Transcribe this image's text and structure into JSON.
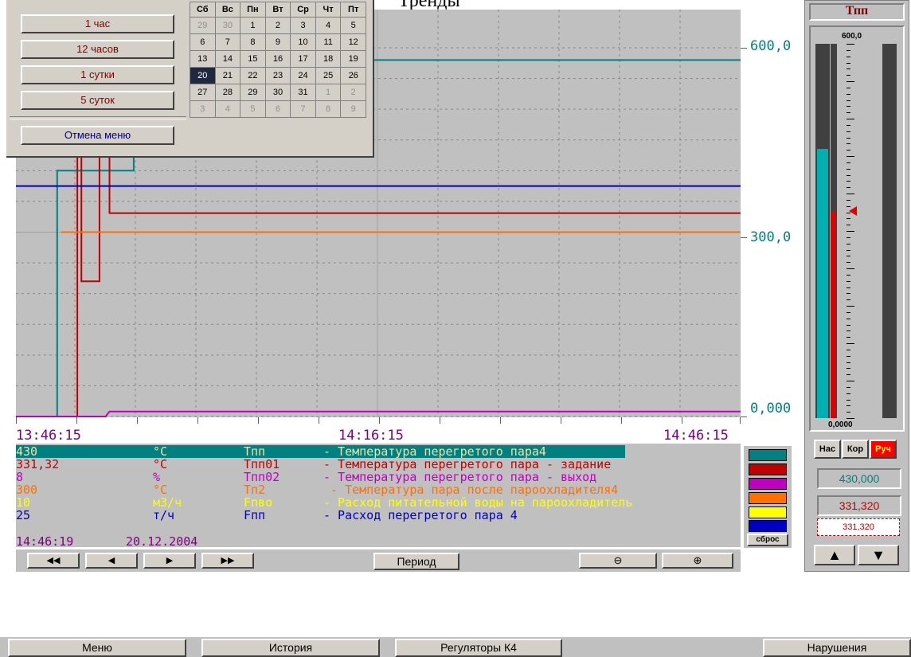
{
  "window_title": "Тренды",
  "axes": {
    "y_labels": [
      "600,0",
      "300,0",
      "0,000"
    ],
    "x_labels": [
      "13:46:15",
      "14:16:15",
      "14:46:15"
    ]
  },
  "period_menu": {
    "items": [
      "1 час",
      "12 часов",
      "1 сутки",
      "5 суток"
    ],
    "cancel": "Отмена меню"
  },
  "calendar": {
    "weekdays": [
      "Сб",
      "Вс",
      "Пн",
      "Вт",
      "Ср",
      "Чт",
      "Пт"
    ],
    "weeks": [
      [
        {
          "d": "29",
          "g": true
        },
        {
          "d": "30",
          "g": true
        },
        {
          "d": "1"
        },
        {
          "d": "2"
        },
        {
          "d": "3"
        },
        {
          "d": "4"
        },
        {
          "d": "5"
        }
      ],
      [
        {
          "d": "6"
        },
        {
          "d": "7"
        },
        {
          "d": "8"
        },
        {
          "d": "9"
        },
        {
          "d": "10"
        },
        {
          "d": "11"
        },
        {
          "d": "12"
        }
      ],
      [
        {
          "d": "13"
        },
        {
          "d": "14"
        },
        {
          "d": "15"
        },
        {
          "d": "16"
        },
        {
          "d": "17"
        },
        {
          "d": "18"
        },
        {
          "d": "19"
        }
      ],
      [
        {
          "d": "20",
          "sel": true
        },
        {
          "d": "21"
        },
        {
          "d": "22"
        },
        {
          "d": "23"
        },
        {
          "d": "24"
        },
        {
          "d": "25"
        },
        {
          "d": "26"
        }
      ],
      [
        {
          "d": "27"
        },
        {
          "d": "28"
        },
        {
          "d": "29"
        },
        {
          "d": "30"
        },
        {
          "d": "31"
        },
        {
          "d": "1",
          "g": true
        },
        {
          "d": "2",
          "g": true
        }
      ],
      [
        {
          "d": "3",
          "g": true
        },
        {
          "d": "4",
          "g": true
        },
        {
          "d": "5",
          "g": true
        },
        {
          "d": "6",
          "g": true
        },
        {
          "d": "7",
          "g": true
        },
        {
          "d": "8",
          "g": true
        },
        {
          "d": "9",
          "g": true
        }
      ]
    ]
  },
  "legend": {
    "rows": [
      {
        "value": "430",
        "unit": "°C",
        "tag": "Tпп",
        "desc": "- Температура перегретого пара4",
        "color": "#f0e0a0",
        "highlight": true
      },
      {
        "value": "331,32",
        "unit": "°C",
        "tag": "Tпп01",
        "desc": "- Температура перегретого пара - задание",
        "color": "#c00000"
      },
      {
        "value": "8",
        "unit": "%",
        "tag": "Tпп02",
        "desc": "- Температура перегретого пара - выход",
        "color": "#c000c0"
      },
      {
        "value": "300",
        "unit": "°C",
        "tag": "Tп2",
        "desc": " - Температура пара после пароохладителя4",
        "color": "#ff7000"
      },
      {
        "value": "10",
        "unit": "м3/ч",
        "tag": "Fпво",
        "desc": "- Расход питательной воды на пароохладитель",
        "color": "#ffff00"
      },
      {
        "value": "25",
        "unit": "т/ч",
        "tag": "Fпп",
        "desc": "- Расход перегретого пара 4",
        "color": "#0000c0"
      }
    ],
    "timestamp": "14:46:19",
    "date": "20.12.2004",
    "swatches": [
      "#008080",
      "#c00000",
      "#c000c0",
      "#ff7000",
      "#ffff00",
      "#0000c0"
    ],
    "reset_label": "сброс"
  },
  "nav": {
    "fast_back": "◀◀",
    "back": "◀",
    "forward": "▶",
    "fast_forward": "▶▶",
    "period": "Период",
    "zoom_out": "⊖",
    "zoom_in": "⊕"
  },
  "indicator": {
    "title": "Тпп",
    "max": "600,0",
    "min": "0,0000",
    "level_teal": 0.72,
    "level_red": 0.553,
    "mode_nas": "Нас",
    "mode_kor": "Кор",
    "mode_ruch": "Руч",
    "value1": "430,000",
    "value2": "331,320",
    "value3": "331,320",
    "up": "▲",
    "down": "▼"
  },
  "taskbar": {
    "menu": "Меню",
    "history": "История",
    "regulators": "Регуляторы К4",
    "violations": "Нарушения"
  },
  "chart_data": {
    "type": "line",
    "x": [
      "13:46:15",
      "14:16:15",
      "14:46:15"
    ],
    "ylim": [
      0,
      600
    ],
    "grid": true,
    "series": [
      {
        "name": "Tпп",
        "color": "#008080",
        "points": [
          [
            "13:46:15",
            0
          ],
          [
            "13:49:40",
            0
          ],
          [
            "13:49:40",
            400
          ],
          [
            "13:56:00",
            400
          ],
          [
            "13:56:00",
            580
          ],
          [
            "14:46:15",
            580
          ]
        ]
      },
      {
        "name": "Tпп01",
        "color": "#c00000",
        "points": [
          [
            "13:51:20",
            0
          ],
          [
            "13:51:20",
            540
          ],
          [
            "13:51:40",
            540
          ],
          [
            "13:51:40",
            220
          ],
          [
            "13:53:10",
            220
          ],
          [
            "13:53:10",
            540
          ],
          [
            "13:54:00",
            540
          ],
          [
            "13:54:00",
            331
          ],
          [
            "14:46:15",
            331
          ]
        ]
      },
      {
        "name": "Tпп02",
        "color": "#c000c0",
        "points": [
          [
            "13:46:15",
            0
          ],
          [
            "13:53:40",
            0
          ],
          [
            "13:54:00",
            8
          ],
          [
            "14:46:15",
            8
          ]
        ]
      },
      {
        "name": "Tп2",
        "color": "#ff7000",
        "points": [
          [
            "13:50:00",
            300
          ],
          [
            "14:46:15",
            300
          ]
        ]
      },
      {
        "name": "Fпп",
        "color": "#0000c0",
        "points": [
          [
            "13:46:15",
            375
          ],
          [
            "14:46:15",
            375
          ]
        ]
      }
    ]
  }
}
